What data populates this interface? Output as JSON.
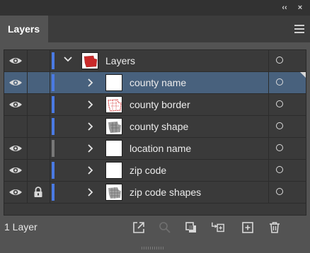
{
  "window": {
    "collapse_glyph": "‹‹",
    "close_glyph": "×"
  },
  "panel": {
    "tab_label": "Layers",
    "menu_icon": "hamburger-menu-icon"
  },
  "layers_root": {
    "label": "Layers",
    "visible": true,
    "expanded": true,
    "color": "#4a7ae3",
    "thumbnail": "red-map"
  },
  "sublayers": [
    {
      "label": "county name",
      "visible": true,
      "locked": false,
      "selected": true,
      "color": "#4a7ae3",
      "thumbnail": "blank"
    },
    {
      "label": "county border",
      "visible": true,
      "locked": false,
      "selected": false,
      "color": "#4a7ae3",
      "thumbnail": "red-map"
    },
    {
      "label": "county shape",
      "visible": false,
      "locked": false,
      "selected": false,
      "color": "#4a7ae3",
      "thumbnail": "grey-map"
    },
    {
      "label": "location name",
      "visible": true,
      "locked": false,
      "selected": false,
      "color": "#787878",
      "thumbnail": "blank"
    },
    {
      "label": "zip code",
      "visible": true,
      "locked": false,
      "selected": false,
      "color": "#4a7ae3",
      "thumbnail": "blank"
    },
    {
      "label": "zip code shapes",
      "visible": true,
      "locked": true,
      "selected": false,
      "color": "#4a7ae3",
      "thumbnail": "grey-map"
    }
  ],
  "footer": {
    "count_text": "1 Layer",
    "icons": [
      "export-icon",
      "search-icon",
      "clipping-mask-icon",
      "move-to-layer-icon",
      "new-sublayer-icon",
      "delete-icon"
    ]
  }
}
